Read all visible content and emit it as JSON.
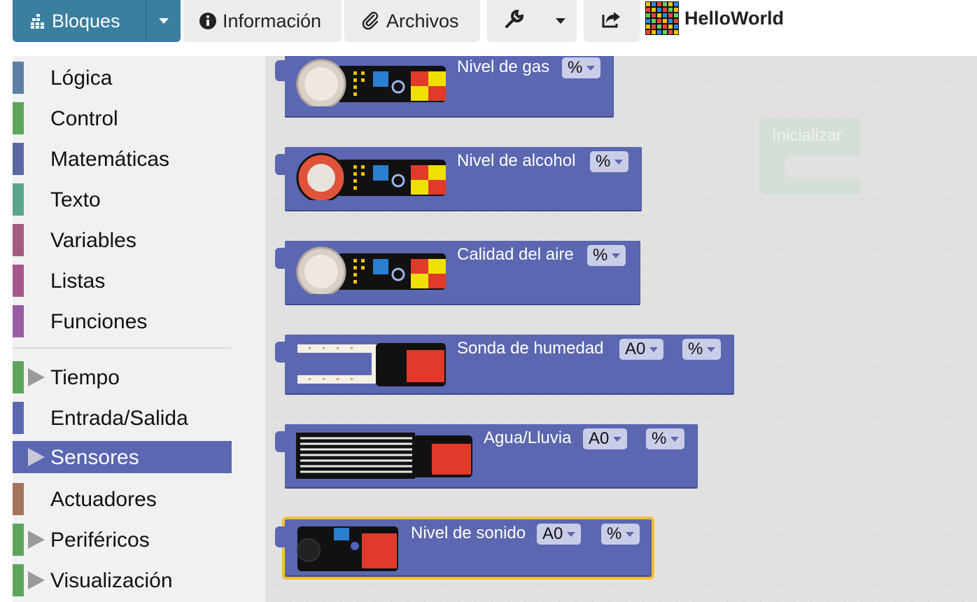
{
  "toolbar": {
    "bloques_label": "Bloques",
    "informacion_label": "Información",
    "archivos_label": "Archivos",
    "project_name": "HelloWorld",
    "accent_color": "#3a7ea0"
  },
  "toolbox": {
    "categories": [
      {
        "label": "Lógica",
        "color": "#5b80a5"
      },
      {
        "label": "Control",
        "color": "#5ba55b"
      },
      {
        "label": "Matemáticas",
        "color": "#5b67a5"
      },
      {
        "label": "Texto",
        "color": "#5ba58c"
      },
      {
        "label": "Variables",
        "color": "#a55b80"
      },
      {
        "label": "Listas",
        "color": "#a5578c"
      },
      {
        "label": "Funciones",
        "color": "#995ba5"
      },
      {
        "label": "Tiempo",
        "color": "#5ba55b",
        "expandable": true
      },
      {
        "label": "Entrada/Salida",
        "color": "#5b67b0"
      },
      {
        "label": "Sensores",
        "color": "#5b67b0",
        "expandable": true,
        "selected": true
      },
      {
        "label": "Actuadores",
        "color": "#a5745b"
      },
      {
        "label": "Periféricos",
        "color": "#5ba55b",
        "expandable": true
      },
      {
        "label": "Visualización",
        "color": "#5ba55b",
        "expandable": true
      }
    ]
  },
  "workspace": {
    "init_block_label": "Inicializar",
    "blocks": [
      {
        "title": "Nivel de gas",
        "dropdowns": [
          "%"
        ]
      },
      {
        "title": "Nivel de alcohol",
        "dropdowns": [
          "%"
        ]
      },
      {
        "title": "Calidad del aire",
        "dropdowns": [
          "%"
        ]
      },
      {
        "title": "Sonda de humedad",
        "dropdowns": [
          "A0",
          "%"
        ]
      },
      {
        "title": "Agua/Lluvia",
        "dropdowns": [
          "A0",
          "%"
        ]
      },
      {
        "title": "Nivel de sonido",
        "dropdowns": [
          "A0",
          "%"
        ],
        "selected": true
      }
    ]
  }
}
